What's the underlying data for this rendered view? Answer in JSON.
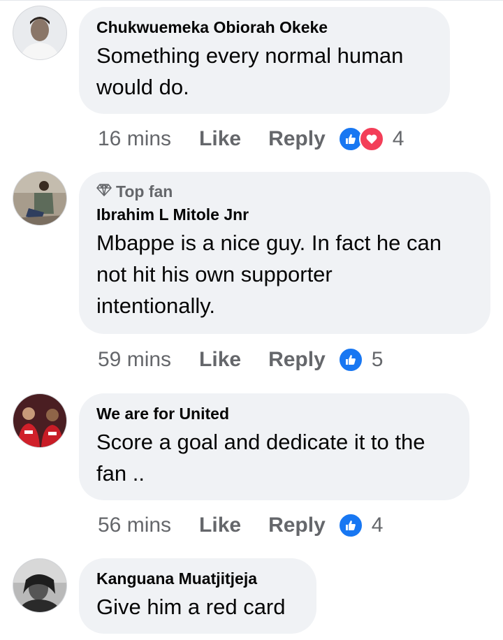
{
  "comments": [
    {
      "author": "Chukwuemeka Obiorah Okeke",
      "text_lines": [
        "Something every normal human",
        "would do."
      ],
      "time": "16 mins",
      "like_label": "Like",
      "reply_label": "Reply",
      "reactions": [
        "like",
        "love"
      ],
      "reaction_count": "4"
    },
    {
      "badge": "Top fan",
      "author": "Ibrahim L Mitole Jnr",
      "text_lines": [
        "Mbappe is a nice guy. In fact he can",
        "not hit his own supporter",
        "intentionally."
      ],
      "time": "59 mins",
      "like_label": "Like",
      "reply_label": "Reply",
      "reactions": [
        "like"
      ],
      "reaction_count": "5"
    },
    {
      "author": "We are for United",
      "text_lines": [
        "Score a goal and dedicate it to the",
        "fan .."
      ],
      "time": "56 mins",
      "like_label": "Like",
      "reply_label": "Reply",
      "reactions": [
        "like"
      ],
      "reaction_count": "4"
    },
    {
      "author": "Kanguana Muatjitjeja",
      "text_lines": [
        "Give him a red card"
      ]
    }
  ],
  "colors": {
    "like": "#1877f2",
    "love": "#f33e58",
    "bubble": "#f0f2f5",
    "meta": "#65676b"
  }
}
